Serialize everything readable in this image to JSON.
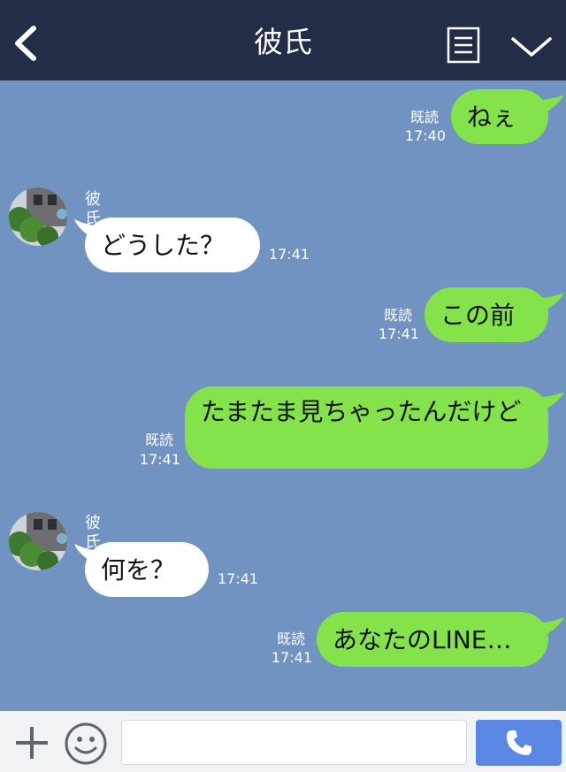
{
  "header": {
    "title": "彼氏",
    "icons": [
      "back-chevron-icon",
      "menu-lines-icon",
      "chevron-down-icon"
    ]
  },
  "messages": [
    {
      "direction": "out",
      "text": "ねぇ",
      "read": "既読",
      "time": "17:40"
    },
    {
      "direction": "in",
      "sender": "彼氏",
      "text": "どうした？",
      "time": "17:41"
    },
    {
      "direction": "out",
      "text": "この前",
      "read": "既読",
      "time": "17:41"
    },
    {
      "direction": "out",
      "text": "たまたま見ちゃったんだけど",
      "read": "既読",
      "time": "17:41"
    },
    {
      "direction": "in",
      "sender": "彼氏",
      "text": "何を？",
      "time": "17:41"
    },
    {
      "direction": "out",
      "text": "あなたのLINE…",
      "read": "既読",
      "time": "17:41"
    }
  ],
  "input_bar": {
    "placeholder": "",
    "value": "",
    "icons": [
      "plus-icon",
      "smiley-icon",
      "phone-icon"
    ]
  },
  "colors": {
    "header": "#232d47",
    "chat_background": "#7093c2",
    "outgoing_bubble": "#84e34a",
    "incoming_bubble": "#ffffff",
    "call_button": "#5b87e4"
  }
}
